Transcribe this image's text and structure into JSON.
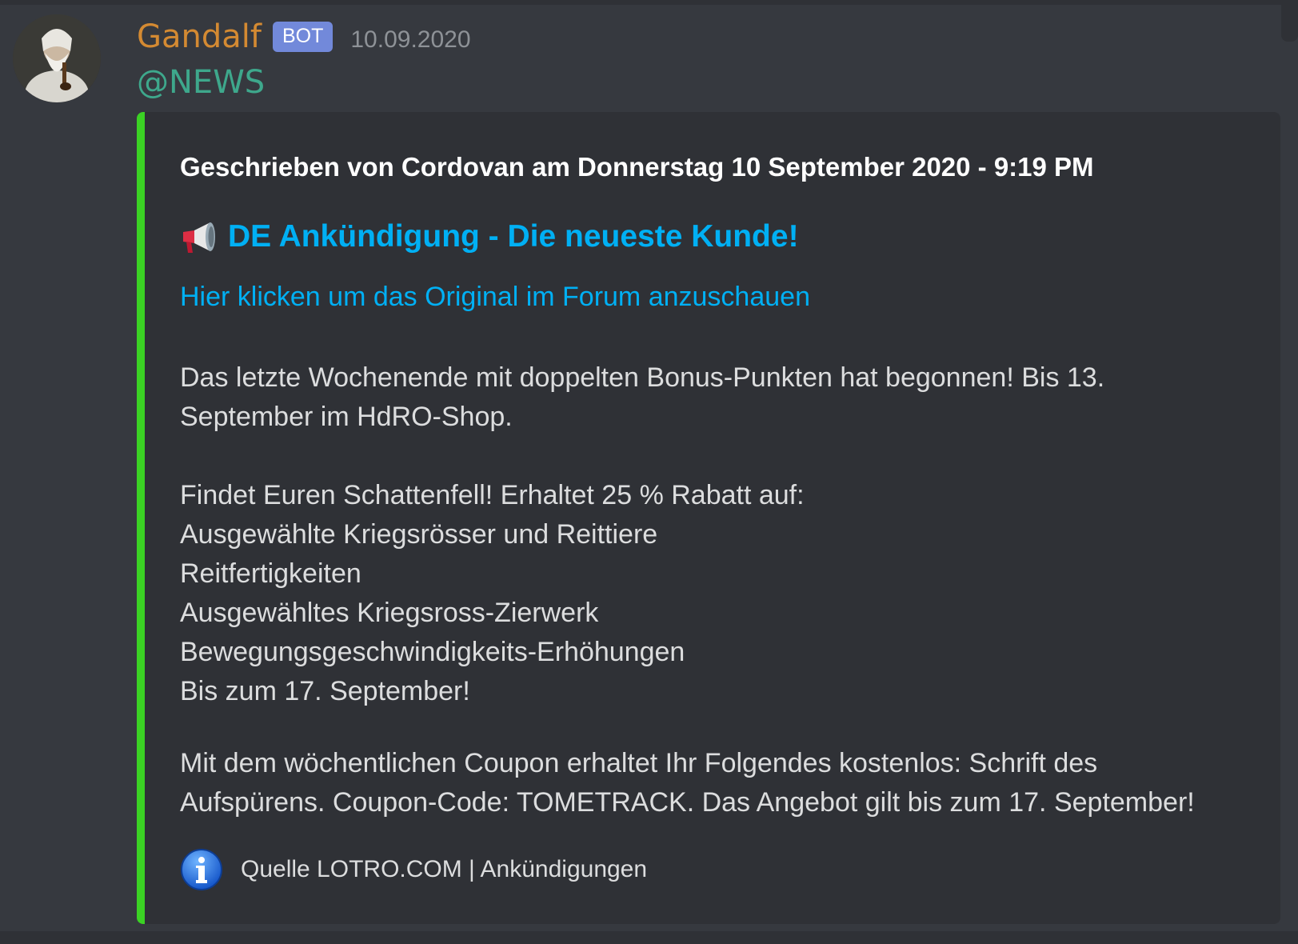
{
  "message": {
    "username": "Gandalf",
    "bot_badge": "BOT",
    "timestamp": "10.09.2020",
    "mention": "@NEWS",
    "username_color": "#d48a32",
    "mention_color": "#3ea88c",
    "avatar_icon": "gandalf-avatar"
  },
  "embed": {
    "accent_color": "#3bd224",
    "author": "Geschrieben von Cordovan am Donnerstag 10 September 2020 - 9:19 PM",
    "title_icon": "megaphone-icon",
    "title": "DE Ankündigung - Die neueste Kunde!",
    "link": "Hier klicken um das Original im Forum anzuschauen",
    "paragraph1": [
      "Das letzte Wochenende mit doppelten Bonus-Punkten hat begonnen! Bis 13.",
      "September im HdRO-Shop."
    ],
    "paragraph2": [
      "Findet Euren Schattenfell! Erhaltet 25 % Rabatt auf:",
      "Ausgewählte Kriegsrösser und Reittiere",
      "Reitfertigkeiten",
      "Ausgewähltes Kriegsross-Zierwerk",
      "Bewegungsgeschwindigkeits-Erhöhungen",
      "Bis zum 17. September!"
    ],
    "paragraph3": [
      "Mit dem wöchentlichen Coupon erhaltet Ihr Folgendes kostenlos: Schrift des",
      "Aufspürens. Coupon-Code: TOMETRACK. Das Angebot gilt bis zum 17. September!"
    ],
    "footer_icon": "info-icon",
    "footer": "Quelle LOTRO.COM | Ankündigungen"
  }
}
